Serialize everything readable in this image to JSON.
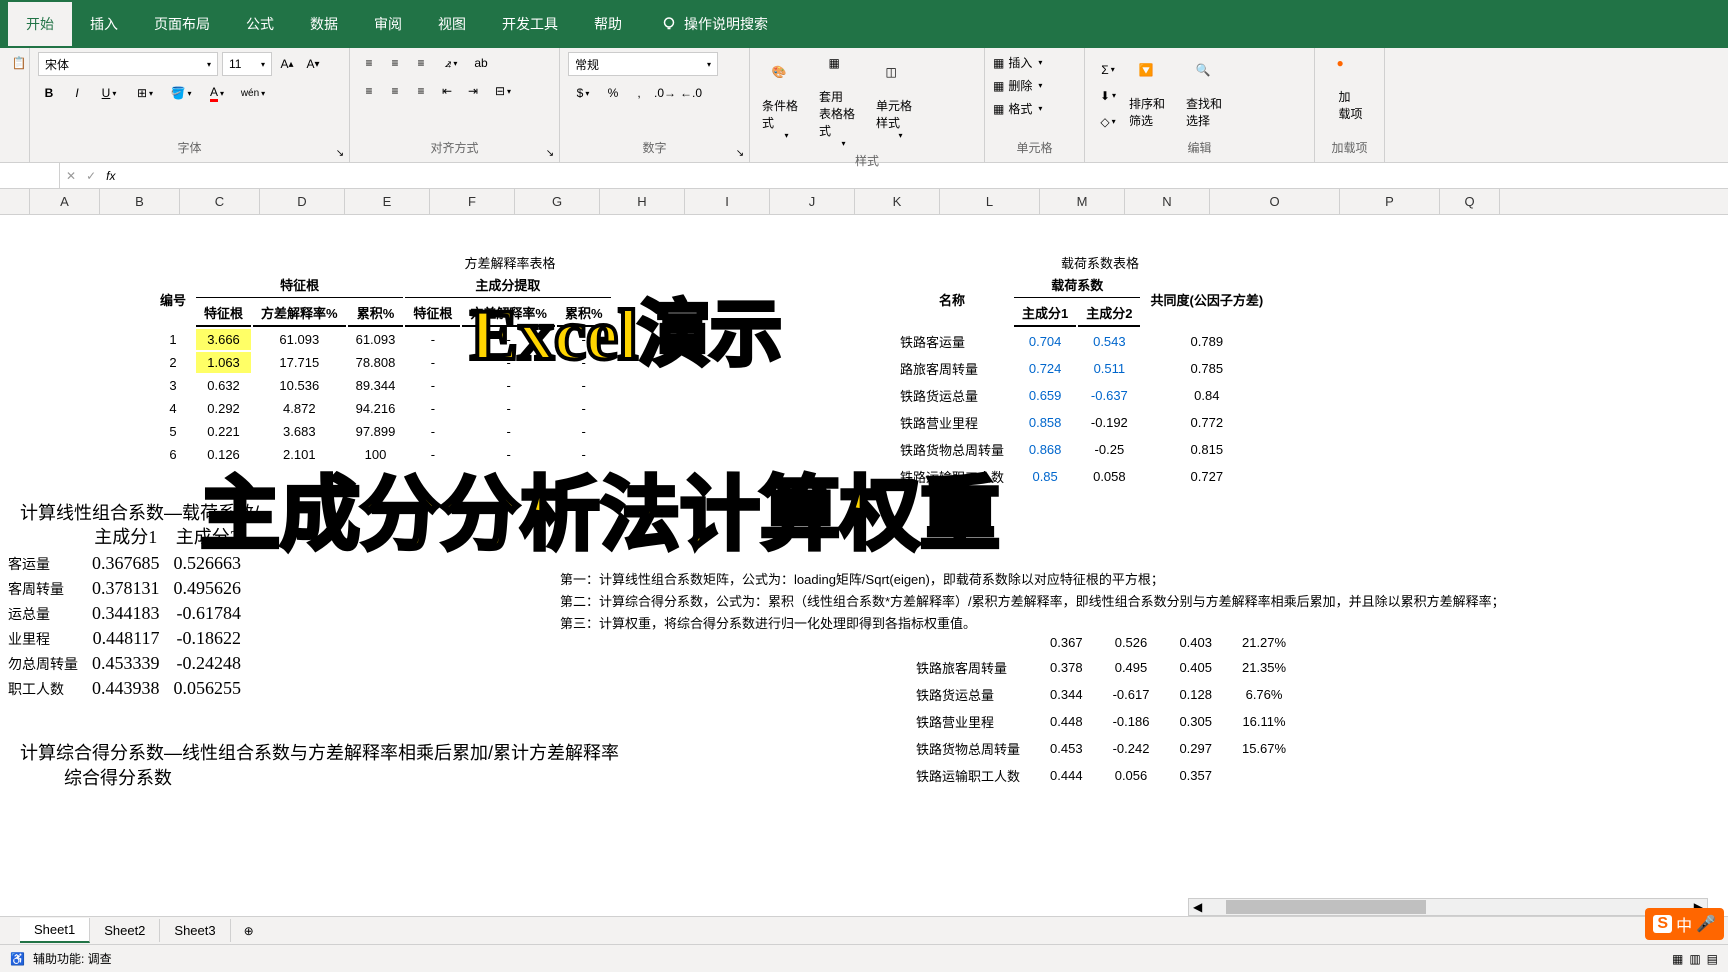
{
  "ribbon": {
    "tabs": [
      "开始",
      "插入",
      "页面布局",
      "公式",
      "数据",
      "审阅",
      "视图",
      "开发工具",
      "帮助"
    ],
    "tell_me": "操作说明搜索",
    "font_name": "宋体",
    "font_size": "11",
    "number_format": "常规",
    "groups": {
      "font": "字体",
      "align": "对齐方式",
      "number": "数字",
      "styles": "样式",
      "cells": "单元格",
      "editing": "编辑",
      "addins": "加载项"
    },
    "cond_format": "条件格式",
    "table_format": "套用\n表格格式",
    "cell_style": "单元格样式",
    "insert": "插入",
    "delete": "删除",
    "format": "格式",
    "sort_filter": "排序和筛选",
    "find_select": "查找和选择",
    "addins_btn": "加\n载项"
  },
  "columns": [
    "A",
    "B",
    "C",
    "D",
    "E",
    "F",
    "G",
    "H",
    "I",
    "J",
    "K",
    "L",
    "M",
    "N",
    "O",
    "P",
    "Q"
  ],
  "table1": {
    "title": "方差解释率表格",
    "h_number": "编号",
    "h_eigen_group": "特征根",
    "h_pca_group": "主成分提取",
    "h_eigen": "特征根",
    "h_var": "方差解释率%",
    "h_cum": "累积%",
    "rows": [
      {
        "n": "1",
        "eigen": "3.666",
        "var": "61.093",
        "cum": "61.093"
      },
      {
        "n": "2",
        "eigen": "1.063",
        "var": "17.715",
        "cum": "78.808"
      },
      {
        "n": "3",
        "eigen": "0.632",
        "var": "10.536",
        "cum": "89.344"
      },
      {
        "n": "4",
        "eigen": "0.292",
        "var": "4.872",
        "cum": "94.216"
      },
      {
        "n": "5",
        "eigen": "0.221",
        "var": "3.683",
        "cum": "97.899"
      },
      {
        "n": "6",
        "eigen": "0.126",
        "var": "2.101",
        "cum": "100"
      }
    ]
  },
  "table2": {
    "title": "载荷系数表格",
    "h_name": "名称",
    "h_loading_group": "载荷系数",
    "h_pc1": "主成分1",
    "h_pc2": "主成分2",
    "h_commun": "共同度(公因子方差)",
    "rows": [
      {
        "name": "铁路客运量",
        "pc1": "0.704",
        "pc2": "0.543",
        "com": "0.789"
      },
      {
        "name": "路旅客周转量",
        "pc1": "0.724",
        "pc2": "0.511",
        "com": "0.785"
      },
      {
        "name": "铁路货运总量",
        "pc1": "0.659",
        "pc2": "-0.637",
        "com": "0.84"
      },
      {
        "name": "铁路营业里程",
        "pc1": "0.858",
        "pc2": "-0.192",
        "com": "0.772"
      },
      {
        "name": "铁路货物总周转量",
        "pc1": "0.868",
        "pc2": "-0.25",
        "com": "0.815"
      },
      {
        "name": "铁路运输职工人数",
        "pc1": "0.85",
        "pc2": "0.058",
        "com": "0.727"
      }
    ]
  },
  "calc_section": {
    "title": "计算线性组合系数—载荷系数/..",
    "h_pc1": "主成分1",
    "h_pc2": "主成分2",
    "rows": [
      {
        "label": "客运量",
        "v1": "0.367685",
        "v2": "0.526663"
      },
      {
        "label": "客周转量",
        "v1": "0.378131",
        "v2": "0.495626"
      },
      {
        "label": "运总量",
        "v1": "0.344183",
        "v2": "-0.61784"
      },
      {
        "label": "业里程",
        "v1": "0.448117",
        "v2": "-0.18622"
      },
      {
        "label": "勿总周转量",
        "v1": "0.453339",
        "v2": "-0.24248"
      },
      {
        "label": "职工人数",
        "v1": "0.443938",
        "v2": "0.056255"
      }
    ]
  },
  "notes": {
    "line1": "第一：计算线性组合系数矩阵，公式为：loading矩阵/Sqrt(eigen)，即载荷系数除以对应特征根的平方根；",
    "line2": "第二：计算综合得分系数，公式为：累积（线性组合系数*方差解释率）/累积方差解释率，即线性组合系数分别与方差解释率相乘后累加，并且除以累积方差解释率；",
    "line3": "第三：计算权重，将综合得分系数进行归一化处理即得到各指标权重值。"
  },
  "weight_table": {
    "rows": [
      {
        "name": "",
        "v1": "0.367",
        "v2": "0.526",
        "v3": "0.403",
        "v4": "21.27%"
      },
      {
        "name": "铁路旅客周转量",
        "v1": "0.378",
        "v2": "0.495",
        "v3": "0.405",
        "v4": "21.35%"
      },
      {
        "name": "铁路货运总量",
        "v1": "0.344",
        "v2": "-0.617",
        "v3": "0.128",
        "v4": "6.76%"
      },
      {
        "name": "铁路营业里程",
        "v1": "0.448",
        "v2": "-0.186",
        "v3": "0.305",
        "v4": "16.11%"
      },
      {
        "name": "铁路货物总周转量",
        "v1": "0.453",
        "v2": "-0.242",
        "v3": "0.297",
        "v4": "15.67%"
      },
      {
        "name": "铁路运输职工人数",
        "v1": "0.444",
        "v2": "0.056",
        "v3": "0.357",
        "v4": ""
      }
    ]
  },
  "formula2_title": "计算综合得分系数—线性组合系数与方差解释率相乘后累加/累计方差解释率",
  "formula2_sub": "综合得分系数",
  "overlay1": "Excel演示",
  "overlay2": "主成分分析法计算权重",
  "sheets": [
    "Sheet1",
    "Sheet2",
    "Sheet3"
  ],
  "status": {
    "accessibility": "辅助功能: 调查"
  },
  "ime": "中"
}
